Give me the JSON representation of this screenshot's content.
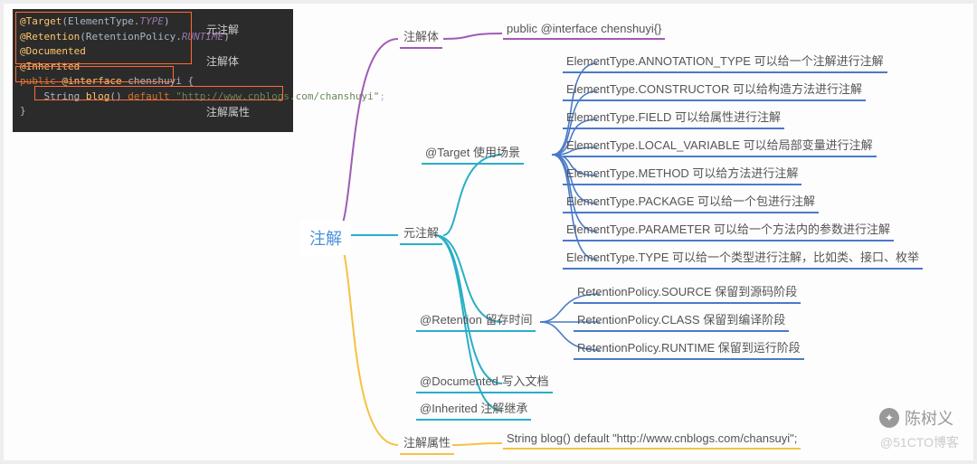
{
  "code": {
    "l1a": "@Target",
    "l1b": "(ElementType.",
    "l1c": "TYPE",
    "l1d": ")",
    "l2a": "@Retention",
    "l2b": "(RetentionPolicy.",
    "l2c": "RUNTIME",
    "l2d": ")",
    "l3": "@Documented",
    "l4": "@Inherited",
    "l5a": "public ",
    "l5b": "@interface ",
    "l5c": "chenshuyi ",
    "l5d": "{",
    "l6a": "String ",
    "l6b": "blog",
    "l6c": "() ",
    "l6d": "default ",
    "l6e": "\"http://www.cnblogs.com/chanshuyi\"",
    "l6f": ";",
    "l7": "}",
    "label1": "元注解",
    "label2": "注解体",
    "label3": "注解属性"
  },
  "root": "注解",
  "branch1": {
    "label": "注解体",
    "value": "public @interface chenshuyi{}"
  },
  "branch2": {
    "label": "元注解",
    "target": {
      "label": "@Target 使用场景",
      "items": [
        "ElementType.ANNOTATION_TYPE 可以给一个注解进行注解",
        "ElementType.CONSTRUCTOR 可以给构造方法进行注解",
        "ElementType.FIELD 可以给属性进行注解",
        "ElementType.LOCAL_VARIABLE 可以给局部变量进行注解",
        "ElementType.METHOD 可以给方法进行注解",
        "ElementType.PACKAGE 可以给一个包进行注解",
        "ElementType.PARAMETER 可以给一个方法内的参数进行注解",
        "ElementType.TYPE 可以给一个类型进行注解，比如类、接口、枚举"
      ]
    },
    "retention": {
      "label": "@Retention 留存时间",
      "items": [
        "RetentionPolicy.SOURCE 保留到源码阶段",
        "RetentionPolicy.CLASS 保留到编译阶段",
        "RetentionPolicy.RUNTIME 保留到运行阶段"
      ]
    },
    "documented": "@Documented 写入文档",
    "inherited": "@Inherited 注解继承"
  },
  "branch3": {
    "label": "注解属性",
    "value": "String blog() default \"http://www.cnblogs.com/chansuyi\";"
  },
  "watermark1": "陈树义",
  "watermark2": "@51CTO博客"
}
